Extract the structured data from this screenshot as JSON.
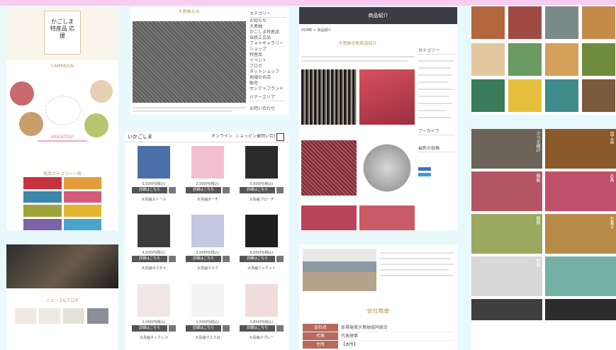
{
  "colors": {
    "pink_band": "#f9cdf0",
    "bg": "#e9f8fb",
    "gold": "#b8965a",
    "button": "#555555"
  },
  "p1": {
    "header_vertical": "かごしま 特産品 応援",
    "sub": "CAMPAIGN",
    "ribbon": "ARIGATOU!",
    "list_title": "商品カテゴリー一覧"
  },
  "p2": {
    "title": "大島紬とは",
    "side_title": "カテゴリー",
    "side_items": [
      "お知らせ",
      "大島紬",
      "かごしま特産品",
      "伝統工芸品",
      "フォトギャラリー",
      "ショップ",
      "特産品",
      "イベント",
      "ブログ",
      "ネットショップ",
      "地域のお店",
      "販売",
      "セレクトブランド"
    ],
    "side_title2": "バナーエリア",
    "side_btn": "お問い合わせ"
  },
  "p3": {
    "header": "商品紹介",
    "breadcrumb": "HOME > 商品紹介",
    "title": "大島紬の新商品紹介",
    "side_title": "カテゴリー",
    "side_title2": "アーカイブ",
    "side_title3": "最新の投稿"
  },
  "p4": {
    "logo": "いかごしま",
    "nav": [
      "オンライン",
      "ショッピング",
      "お問い合わせ"
    ],
    "btn": "詳細はこちら",
    "items": [
      {
        "price": "3,000円(税込)",
        "name": "大島紬ストール"
      },
      {
        "price": "2,500円(税込)",
        "name": "大島紬ポーチ"
      },
      {
        "price": "5,000円(税込)",
        "name": "大島紬ブローチ"
      },
      {
        "price": "4,000円(税込)",
        "name": "大島紬ネクタイ"
      },
      {
        "price": "3,500円(税込)",
        "name": "大島紬マスク"
      },
      {
        "price": "6,000円(税込)",
        "name": "大島紬ジャケット"
      },
      {
        "price": "2,000円(税込)",
        "name": "大島紬ネックレス"
      },
      {
        "price": "1,500円(税込)",
        "name": "大島紬マスク白"
      },
      {
        "price": "1,800円(税込)",
        "name": "大島紬スプレー"
      }
    ]
  },
  "p5": {
    "title": "会社概要",
    "rows": [
      {
        "k": "会社名",
        "v": "本場奄美大島紬協同組合"
      },
      {
        "k": "代表",
        "v": "代表理事"
      },
      {
        "k": "住所",
        "v": "【本所】"
      }
    ]
  },
  "p6": {
    "labels": [
      "さつま揚げ",
      "加工品",
      "鶏飯",
      "お茶",
      "鰹節",
      "お菓子",
      "野菜"
    ]
  },
  "p7": {
    "title": "ニュース&ブログ"
  }
}
